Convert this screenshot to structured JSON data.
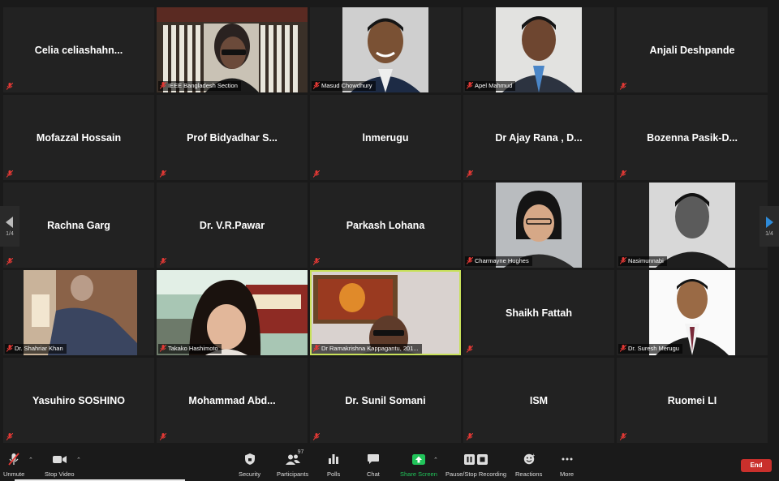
{
  "meeting": {
    "tiles": [
      {
        "name": "Celia  celiashahn...",
        "type": "name"
      },
      {
        "name": "IEEE Bangladesh Section",
        "type": "video"
      },
      {
        "name": "Masud Chowdhury",
        "type": "video"
      },
      {
        "name": "Apel Mahmud",
        "type": "video"
      },
      {
        "name": "Anjali Deshpande",
        "type": "name"
      },
      {
        "name": "Mofazzal Hossain",
        "type": "name"
      },
      {
        "name": "Prof Bidyadhar S...",
        "type": "name"
      },
      {
        "name": "lnmerugu",
        "type": "name"
      },
      {
        "name": "Dr Ajay Rana , D...",
        "type": "name"
      },
      {
        "name": "Bozenna  Pasik-D...",
        "type": "name"
      },
      {
        "name": "Rachna Garg",
        "type": "name"
      },
      {
        "name": "Dr. V.R.Pawar",
        "type": "name"
      },
      {
        "name": "Parkash Lohana",
        "type": "name"
      },
      {
        "name": "Charmayne Hughes",
        "type": "video"
      },
      {
        "name": "Nasimunnabi",
        "type": "video"
      },
      {
        "name": "Dr. Shahriar Khan",
        "type": "video"
      },
      {
        "name": "Takako Hashimoto",
        "type": "video"
      },
      {
        "name": "Dr Ramakrishna Kappagantu, 201...",
        "type": "video",
        "active": true
      },
      {
        "name": "Shaikh Fattah",
        "type": "name"
      },
      {
        "name": "Dr. Suresh Merugu",
        "type": "video"
      },
      {
        "name": "Yasuhiro SOSHINO",
        "type": "name"
      },
      {
        "name": "Mohammad  Abd...",
        "type": "name"
      },
      {
        "name": "Dr. Sunil Somani",
        "type": "name"
      },
      {
        "name": "ISM",
        "type": "name"
      },
      {
        "name": "Ruomei LI",
        "type": "name"
      }
    ],
    "page_left": "1/4",
    "page_right": "1/4"
  },
  "toolbar": {
    "unmute": "Unmute",
    "stop_video": "Stop Video",
    "security": "Security",
    "participants": "Participants",
    "participant_count": "97",
    "polls": "Polls",
    "chat": "Chat",
    "share_screen": "Share Screen",
    "recording": "Pause/Stop Recording",
    "reactions": "Reactions",
    "more": "More",
    "end": "End"
  },
  "colors": {
    "mute_red": "#e53935",
    "share_green": "#21c45a",
    "end_red": "#c9302c",
    "nav_blue": "#2e8bd9",
    "active_border": "#c8e15a"
  }
}
